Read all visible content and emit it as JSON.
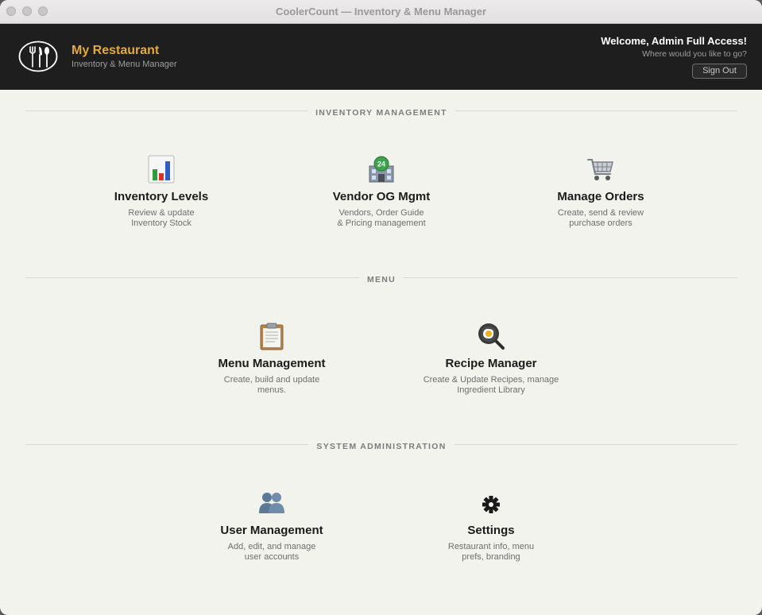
{
  "window": {
    "title": "CoolerCount — Inventory & Menu Manager"
  },
  "header": {
    "brand_name": "My Restaurant",
    "brand_sub": "Inventory & Menu Manager",
    "welcome": "Welcome, Admin Full Access!",
    "prompt": "Where would you like to go?",
    "signout_label": "Sign Out"
  },
  "sections": [
    {
      "label": "INVENTORY MANAGEMENT",
      "cards": [
        {
          "title": "Inventory Levels",
          "desc_1": "Review & update",
          "desc_2": "Inventory Stock",
          "icon": "bar-chart-icon"
        },
        {
          "title": "Vendor OG Mgmt",
          "desc_1": "Vendors, Order Guide",
          "desc_2": "& Pricing management",
          "icon": "store-24-icon"
        },
        {
          "title": "Manage Orders",
          "desc_1": "Create, send & review",
          "desc_2": "purchase orders",
          "icon": "shopping-cart-icon"
        }
      ]
    },
    {
      "label": "MENU",
      "cards": [
        {
          "title": "Menu Management",
          "desc_1": "Create, build and update",
          "desc_2": "menus.",
          "icon": "clipboard-icon"
        },
        {
          "title": "Recipe Manager",
          "desc_1": "Create & Update Recipes, manage",
          "desc_2": "Ingredient Library",
          "icon": "frying-pan-icon"
        }
      ]
    },
    {
      "label": "SYSTEM ADMINISTRATION",
      "cards": [
        {
          "title": "User Management",
          "desc_1": "Add, edit, and manage",
          "desc_2": "user accounts",
          "icon": "users-icon"
        },
        {
          "title": "Settings",
          "desc_1": "Restaurant info, menu",
          "desc_2": "prefs, branding",
          "icon": "gear-icon"
        }
      ]
    }
  ],
  "colors": {
    "accent": "#e3a93b",
    "header_bg": "#1e1e1e",
    "page_bg": "#f3f3ee"
  }
}
